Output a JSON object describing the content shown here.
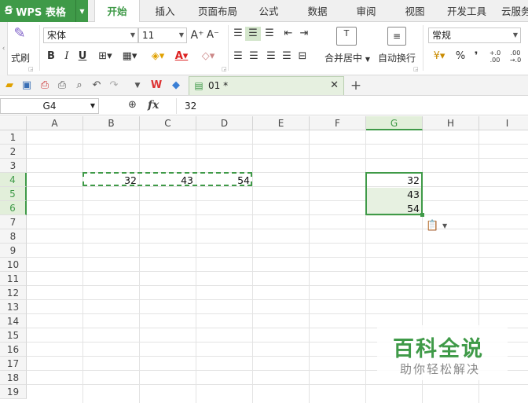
{
  "menubar": {
    "app_name": "WPS 表格",
    "tabs": [
      {
        "label": "开始",
        "active": true
      },
      {
        "label": "插入"
      },
      {
        "label": "页面布局"
      },
      {
        "label": "公式"
      },
      {
        "label": "数据"
      },
      {
        "label": "审阅"
      },
      {
        "label": "视图"
      },
      {
        "label": "开发工具"
      },
      {
        "label": "云服务"
      }
    ]
  },
  "ribbon": {
    "format_painter_label": "式刷",
    "font_name": "宋体",
    "font_size": "11",
    "merge_center_label": "合并居中",
    "wrap_text_label": "自动换行",
    "number_format": "常规",
    "percent_symbol": "%",
    "comma_symbol": "❜"
  },
  "quick_access": {
    "document_tab_label": "01 *"
  },
  "formula_bar": {
    "cell_reference": "G4",
    "formula_value": "32",
    "fx_label": "fx"
  },
  "sheet": {
    "columns": [
      "A",
      "B",
      "C",
      "D",
      "E",
      "F",
      "G",
      "H",
      "I"
    ],
    "selected_column": "G",
    "rows": [
      "1",
      "2",
      "3",
      "4",
      "5",
      "6",
      "7",
      "8",
      "9",
      "10",
      "11",
      "12",
      "13",
      "14",
      "15",
      "16",
      "17",
      "18",
      "19"
    ],
    "selected_rows": [
      "4",
      "5",
      "6"
    ],
    "cells": {
      "B4": "32",
      "C4": "43",
      "D4": "54",
      "G4": "32",
      "G5": "43",
      "G6": "54"
    }
  },
  "watermark": {
    "title": "百科全说",
    "subtitle": "助你轻松解决"
  },
  "colors": {
    "accent": "#3f9a48",
    "selection_fill": "#e7f1e1"
  }
}
